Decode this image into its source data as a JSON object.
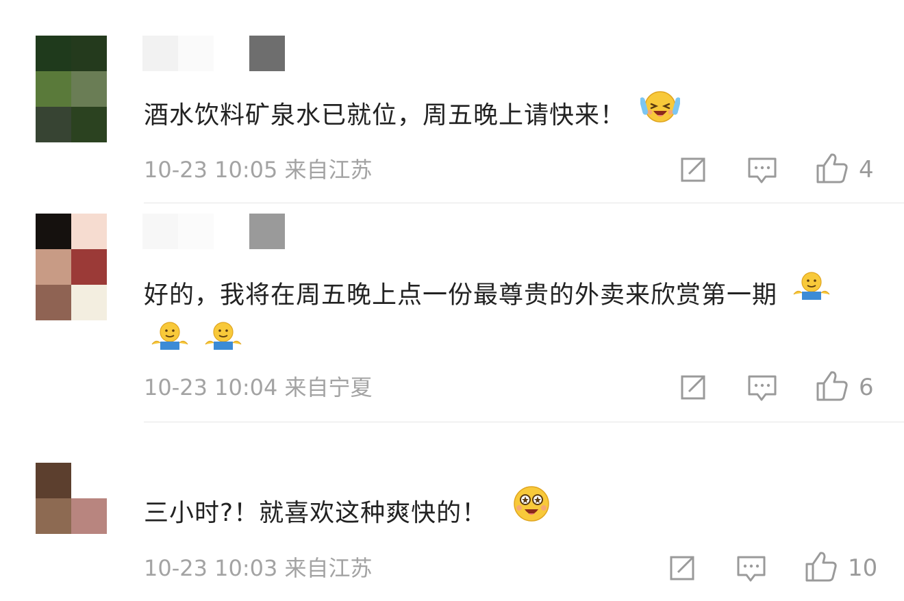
{
  "comments": [
    {
      "text": "酒水饮料矿泉水已就位，周五晚上请快来！",
      "emoji": "laughing-crying-emoji",
      "meta": "10-23 10:05 来自江苏",
      "likes": "4",
      "avatar_colors": [
        "#1f3a1c",
        "#243a1d",
        "#5a7a3a",
        "#6a7d55",
        "#374433",
        "#2b4220"
      ]
    },
    {
      "text": "好的，我将在周五晚上点一份最尊贵的外卖来欣赏第一期",
      "emoji": "shrug-emoji",
      "meta": "10-23 10:04 来自宁夏",
      "likes": "6",
      "avatar_colors": [
        "#15110e",
        "#f6dcd0",
        "#c89b85",
        "#9b3a37",
        "#8f6353",
        "#f3eee0"
      ]
    },
    {
      "text": "三小时?！就喜欢这种爽快的！",
      "emoji": "starry-eyes-emoji",
      "meta": "10-23 10:03 来自江苏",
      "likes": "10",
      "avatar_colors": [
        "#5c3f2e",
        "#ffffff",
        "#8d6a52",
        "#b8857f"
      ]
    }
  ],
  "colors": {
    "meta_text": "#a3a3a3",
    "icon_stroke": "#9a9a9a",
    "divider": "#e6e6e6"
  }
}
